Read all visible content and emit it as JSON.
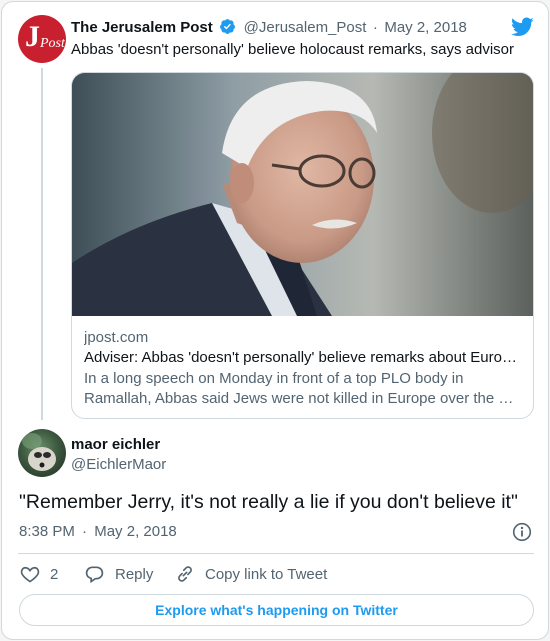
{
  "source_tweet": {
    "author_name": "The Jerusalem Post",
    "author_handle": "@Jerusalem_Post",
    "date": "May 2, 2018",
    "separator": "·",
    "text": "Abbas 'doesn't personally' believe holocaust remarks, says advisor",
    "link_card": {
      "domain": "jpost.com",
      "title": "Adviser: Abbas 'doesn't personally' believe remarks about Euro…",
      "description_line1": "In a long speech on Monday in front of a top PLO body in",
      "description_line2": "Ramallah, Abbas said Jews were not killed in Europe over the …"
    }
  },
  "reply_tweet": {
    "author_name": "maor eichler",
    "author_handle": "@EichlerMaor",
    "text": "\"Remember Jerry, it's not really a lie if you don't believe it\"",
    "time": "8:38 PM",
    "separator": "·",
    "date": "May 2, 2018"
  },
  "actions": {
    "like_count": "2",
    "reply_label": "Reply",
    "copy_link_label": "Copy link to Tweet"
  },
  "explore_button_label": "Explore what's happening on Twitter",
  "colors": {
    "accent": "#1d9bf0",
    "brand_red": "#c8202f",
    "muted_text": "#536471",
    "border": "#cfd9de"
  },
  "icons": [
    "twitter-bird-icon",
    "verified-badge-icon",
    "info-icon",
    "heart-icon",
    "reply-icon",
    "link-icon"
  ]
}
